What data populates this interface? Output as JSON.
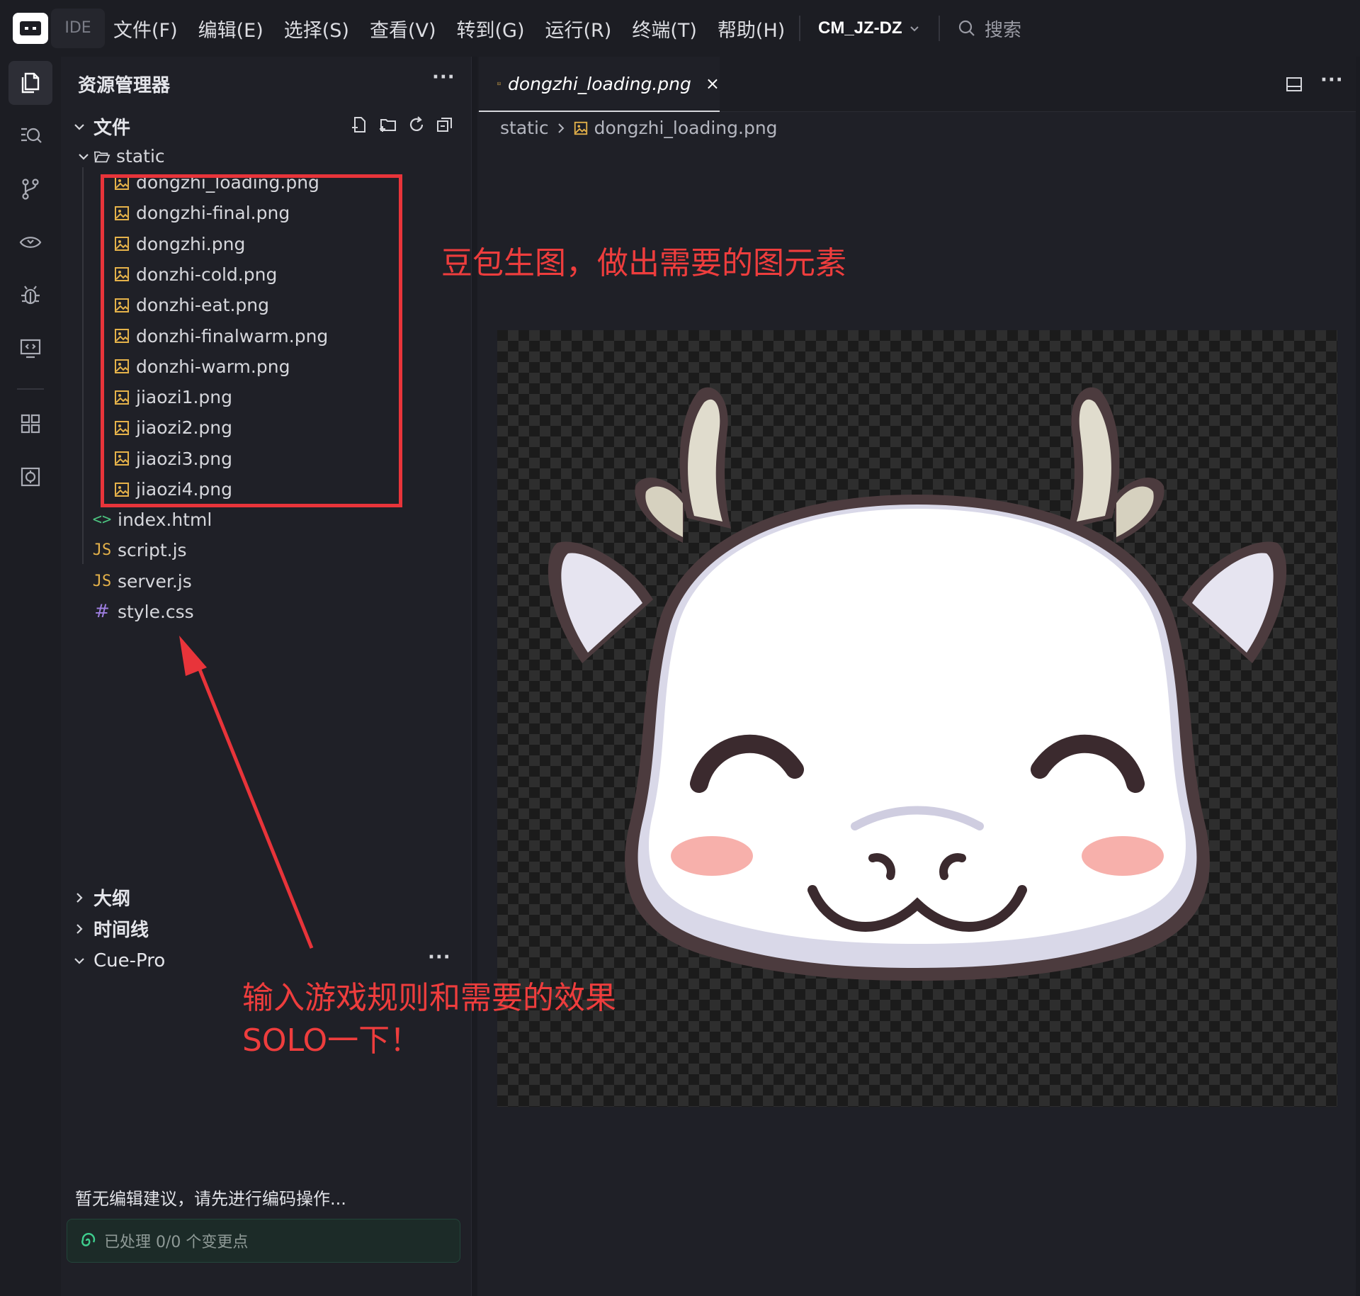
{
  "titlebar": {
    "ide_label": "IDE",
    "menu": [
      "文件(F)",
      "编辑(E)",
      "选择(S)",
      "查看(V)",
      "转到(G)",
      "运行(R)",
      "终端(T)",
      "帮助(H)"
    ],
    "project": "CM_JZ-DZ",
    "search_placeholder": "搜索"
  },
  "activity_bar": {
    "icons": [
      "explorer-icon",
      "search-icon",
      "source-control-icon",
      "remote-icon",
      "debug-icon",
      "preview-icon",
      "extensions-icon",
      "settings-icon"
    ]
  },
  "explorer": {
    "title": "资源管理器",
    "section": "文件",
    "folder": "static",
    "static_files": [
      "dongzhi_loading.png",
      "dongzhi-final.png",
      "dongzhi.png",
      "donzhi-cold.png",
      "donzhi-eat.png",
      "donzhi-finalwarm.png",
      "donzhi-warm.png",
      "jiaozi1.png",
      "jiaozi2.png",
      "jiaozi3.png",
      "jiaozi4.png"
    ],
    "root_files": [
      {
        "name": "index.html",
        "icon": "<>",
        "kind": "html"
      },
      {
        "name": "script.js",
        "icon": "JS",
        "kind": "js"
      },
      {
        "name": "server.js",
        "icon": "JS",
        "kind": "js"
      },
      {
        "name": "style.css",
        "icon": "#",
        "kind": "css"
      }
    ],
    "outline": "大纲",
    "timeline": "时间线",
    "cue_pro": {
      "title": "Cue-Pro",
      "message": "暂无编辑建议，请先进行编码操作...",
      "status": "已处理 0/0 个变更点"
    }
  },
  "editor": {
    "tab_label": "dongzhi_loading.png",
    "tab_close": "×",
    "breadcrumb": [
      "static",
      "dongzhi_loading.png"
    ]
  },
  "annotations": {
    "top_note": "豆包生图，做出需要的图元素",
    "bottom_note_line1": "输入游戏规则和需要的效果",
    "bottom_note_line2": "SOLO一下！"
  },
  "colors": {
    "annotation_red": "#e8343a",
    "image_icon": "#e5b24a",
    "cue_green": "#3fcf8e"
  }
}
